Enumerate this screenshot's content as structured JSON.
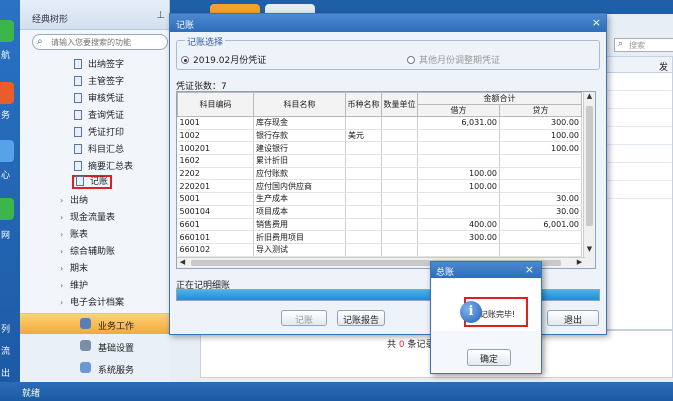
{
  "leftbar": {
    "labels": [
      "航",
      "务",
      "心",
      "网",
      "列",
      "流",
      "出"
    ]
  },
  "tree": {
    "title": "经典树形",
    "search_placeholder": "请输入您要搜索的功能",
    "items": [
      {
        "label": "出纳签字"
      },
      {
        "label": "主管签字"
      },
      {
        "label": "审核凭证"
      },
      {
        "label": "查询凭证"
      },
      {
        "label": "凭证打印"
      },
      {
        "label": "科目汇总"
      },
      {
        "label": "摘要汇总表"
      },
      {
        "label": "记账"
      }
    ],
    "groups": [
      {
        "label": "出纳"
      },
      {
        "label": "现金流量表"
      },
      {
        "label": "账表"
      },
      {
        "label": "综合辅助账"
      },
      {
        "label": "期末"
      },
      {
        "label": "维护"
      },
      {
        "label": "电子会计档案"
      }
    ],
    "workspace": [
      {
        "label": "业务工作"
      },
      {
        "label": "基础设置"
      },
      {
        "label": "系统服务"
      }
    ]
  },
  "background": {
    "search_placeholder": "搜索",
    "col_header": "发",
    "record_count_prefix": "共",
    "record_count": "0",
    "record_count_suffix": "条记录"
  },
  "dialog": {
    "title": "记账",
    "close": "×",
    "section_label": "记账选择",
    "radio1": "2019.02月份凭证",
    "radio2": "其他月份调整期凭证",
    "voucher_count_label": "凭证张数：7",
    "table": {
      "headers": {
        "code": "科目编码",
        "name": "科目名称",
        "currency": "币种名称",
        "unit": "数量单位",
        "amount_group": "金额合计",
        "debit": "借方",
        "credit": "贷方"
      },
      "rows": [
        {
          "code": "1001",
          "name": "库存现金",
          "currency": "",
          "debit": "6,031.00",
          "credit": "300.00"
        },
        {
          "code": "1002",
          "name": "银行存款",
          "currency": "美元",
          "debit": "",
          "credit": "100.00"
        },
        {
          "code": "100201",
          "name": "建设银行",
          "currency": "",
          "debit": "",
          "credit": "100.00"
        },
        {
          "code": "1602",
          "name": "累计折旧",
          "currency": "",
          "debit": "",
          "credit": ""
        },
        {
          "code": "2202",
          "name": "应付账款",
          "currency": "",
          "debit": "100.00",
          "credit": ""
        },
        {
          "code": "220201",
          "name": "应付国内供应商",
          "currency": "",
          "debit": "100.00",
          "credit": ""
        },
        {
          "code": "5001",
          "name": "生产成本",
          "currency": "",
          "debit": "",
          "credit": "30.00"
        },
        {
          "code": "500104",
          "name": "项目成本",
          "currency": "",
          "debit": "",
          "credit": "30.00"
        },
        {
          "code": "6601",
          "name": "销售费用",
          "currency": "",
          "debit": "400.00",
          "credit": "6,001.00"
        },
        {
          "code": "660101",
          "name": "折旧费用项目",
          "currency": "",
          "debit": "300.00",
          "credit": ""
        },
        {
          "code": "660102",
          "name": "导入测试",
          "currency": "",
          "debit": "",
          "credit": ""
        }
      ]
    },
    "progress_label": "正在记明细账",
    "progress": 1.0,
    "btn_post": "记账",
    "btn_report": "记账报告",
    "btn_exit": "退出"
  },
  "alert": {
    "title": "总账",
    "close": "×",
    "icon": "i",
    "message": "记账完毕!",
    "ok": "确定"
  },
  "status": {
    "text": "就绪"
  }
}
